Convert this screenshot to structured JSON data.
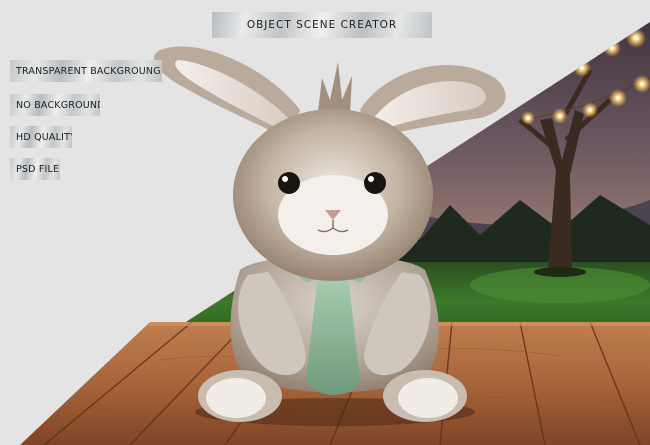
{
  "title": "OBJECT SCENE CREATOR",
  "features": [
    "TRANSPARENT BACKGROUNG",
    "NO BACKGROUND",
    "HD QUALITY",
    "PSD FILE"
  ],
  "colors": {
    "canvas": "#e4e4e4",
    "grass": "#2f6a23",
    "wood": "#a7643a",
    "fur": "#b7a898",
    "bow": "#8fb89a",
    "string_lights": "#ffd27a"
  },
  "subject": "bunny-plush-toy"
}
